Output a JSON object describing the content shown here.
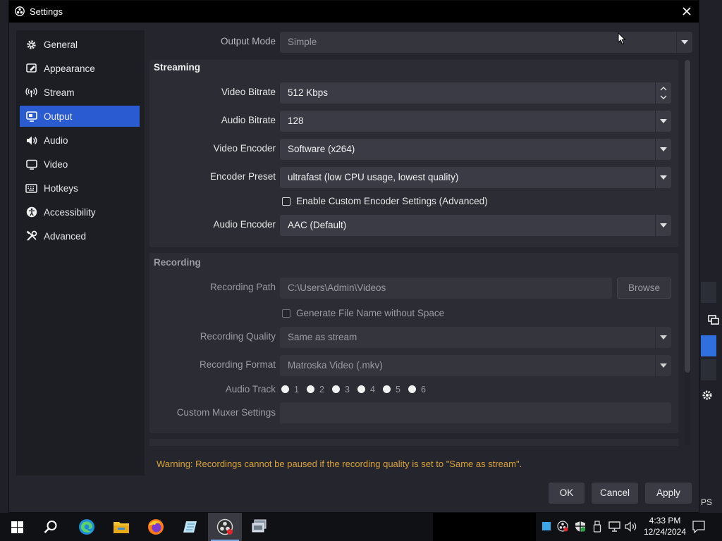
{
  "window": {
    "title": "Settings"
  },
  "sidebar": {
    "items": [
      {
        "label": "General",
        "icon": "gear-icon",
        "active": false
      },
      {
        "label": "Appearance",
        "icon": "appearance-icon",
        "active": false
      },
      {
        "label": "Stream",
        "icon": "stream-icon",
        "active": false
      },
      {
        "label": "Output",
        "icon": "output-icon",
        "active": true
      },
      {
        "label": "Audio",
        "icon": "speaker-icon",
        "active": false
      },
      {
        "label": "Video",
        "icon": "monitor-icon",
        "active": false
      },
      {
        "label": "Hotkeys",
        "icon": "keyboard-icon",
        "active": false
      },
      {
        "label": "Accessibility",
        "icon": "accessibility-icon",
        "active": false
      },
      {
        "label": "Advanced",
        "icon": "tools-icon",
        "active": false
      }
    ]
  },
  "output_mode": {
    "label": "Output Mode",
    "value": "Simple"
  },
  "streaming": {
    "title": "Streaming",
    "video_bitrate": {
      "label": "Video Bitrate",
      "value": "512 Kbps"
    },
    "audio_bitrate": {
      "label": "Audio Bitrate",
      "value": "128"
    },
    "video_encoder": {
      "label": "Video Encoder",
      "value": "Software (x264)"
    },
    "encoder_preset": {
      "label": "Encoder Preset",
      "value": "ultrafast (low CPU usage, lowest quality)"
    },
    "custom_encoder": {
      "label": "Enable Custom Encoder Settings (Advanced)",
      "checked": false
    },
    "audio_encoder": {
      "label": "Audio Encoder",
      "value": "AAC (Default)"
    }
  },
  "recording": {
    "title": "Recording",
    "path": {
      "label": "Recording Path",
      "value": "C:\\Users\\Admin\\Videos",
      "browse": "Browse"
    },
    "no_space": {
      "label": "Generate File Name without Space",
      "checked": false
    },
    "quality": {
      "label": "Recording Quality",
      "value": "Same as stream"
    },
    "format": {
      "label": "Recording Format",
      "value": "Matroska Video (.mkv)"
    },
    "audio_track": {
      "label": "Audio Track",
      "tracks": [
        "1",
        "2",
        "3",
        "4",
        "5",
        "6"
      ]
    },
    "muxer": {
      "label": "Custom Muxer Settings",
      "value": ""
    }
  },
  "warning": "Warning: Recordings cannot be paused if the recording quality is set to \"Same as stream\".",
  "buttons": {
    "ok": "OK",
    "cancel": "Cancel",
    "apply": "Apply"
  },
  "background_app": {
    "fps_fragment": "PS"
  },
  "taskbar": {
    "apps": [
      "windows-start-icon",
      "search-icon",
      "edge-icon",
      "file-explorer-icon",
      "firefox-icon",
      "notepad-icon",
      "obs-icon",
      "app-icon"
    ],
    "time": "4:33 PM",
    "date": "12/24/2024"
  },
  "colors": {
    "accent": "#2b5bd0",
    "warning": "#d8a23a",
    "panel": "#25262d"
  }
}
